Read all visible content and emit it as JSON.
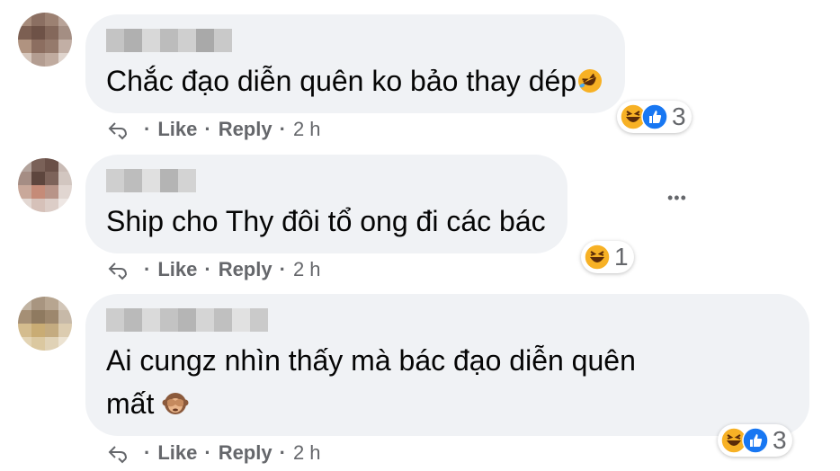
{
  "comments": [
    {
      "text": "Chắc đạo diễn quên ko bảo thay dép",
      "actions": {
        "like": "Like",
        "reply": "Reply",
        "time": "2 h"
      },
      "reactions": {
        "icons": [
          "haha-icon",
          "like-icon"
        ],
        "count": "3"
      }
    },
    {
      "text": "Ship cho Thy đôi tổ ong đi các bác",
      "actions": {
        "like": "Like",
        "reply": "Reply",
        "time": "2 h"
      },
      "reactions": {
        "icons": [
          "haha-icon"
        ],
        "count": "1"
      }
    },
    {
      "text": "Ai cungz nhìn thấy mà bác đạo diễn quên\nmất",
      "actions": {
        "like": "Like",
        "reply": "Reply",
        "time": "2 h"
      },
      "reactions": {
        "icons": [
          "haha-icon",
          "like-icon"
        ],
        "count": "3"
      }
    }
  ],
  "separator": "·",
  "more_options": "•••",
  "colors": {
    "bubble": "#f0f2f5",
    "text": "#050505",
    "secondary": "#65676b",
    "like_blue": "#1877f2",
    "haha_yellow": "#f7b125"
  }
}
